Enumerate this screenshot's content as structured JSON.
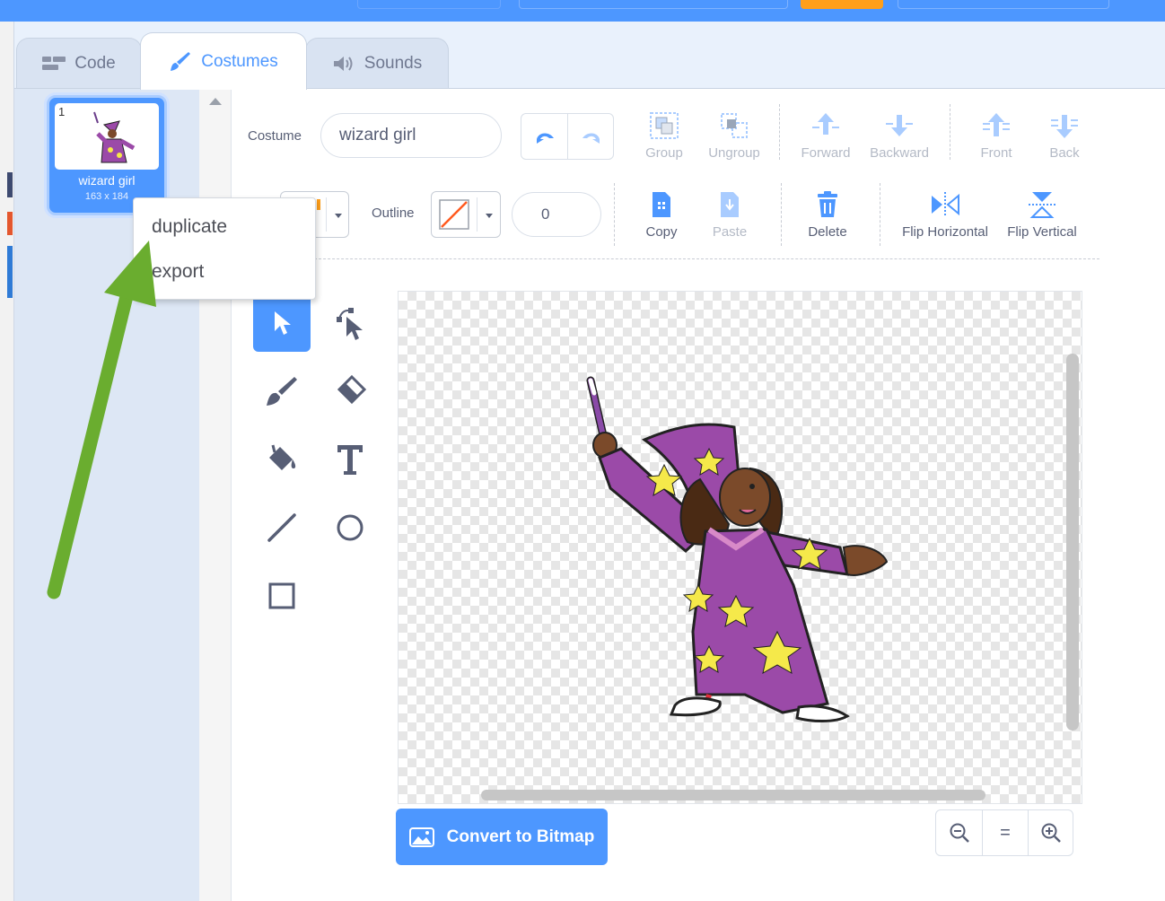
{
  "tabs": [
    {
      "label": "Code",
      "icon": "code-blocks-icon"
    },
    {
      "label": "Costumes",
      "icon": "paintbrush-icon",
      "active": true
    },
    {
      "label": "Sounds",
      "icon": "speaker-icon"
    }
  ],
  "costume_list": {
    "items": [
      {
        "number": "1",
        "name": "wizard girl",
        "size": "163 x 184",
        "selected": true
      }
    ]
  },
  "context_menu": {
    "items": [
      {
        "label": "duplicate"
      },
      {
        "label": "export"
      }
    ]
  },
  "toolbar": {
    "costume_label": "Costume",
    "costume_name": "wizard girl",
    "outline_label": "Outline",
    "outline_width": "0",
    "buttons": {
      "group": "Group",
      "ungroup": "Ungroup",
      "forward": "Forward",
      "backward": "Backward",
      "front": "Front",
      "back": "Back",
      "copy": "Copy",
      "paste": "Paste",
      "delete": "Delete",
      "flip_horizontal": "Flip Horizontal",
      "flip_vertical": "Flip Vertical"
    }
  },
  "tools": [
    "select",
    "reshape",
    "brush",
    "eraser",
    "fill",
    "text",
    "line",
    "circle",
    "rectangle"
  ],
  "bottom": {
    "convert_label": "Convert to Bitmap",
    "zoom_reset": "="
  },
  "colors": {
    "accent": "#4d97ff",
    "annotation_arrow": "#6aad2f",
    "text": "#575e75"
  }
}
